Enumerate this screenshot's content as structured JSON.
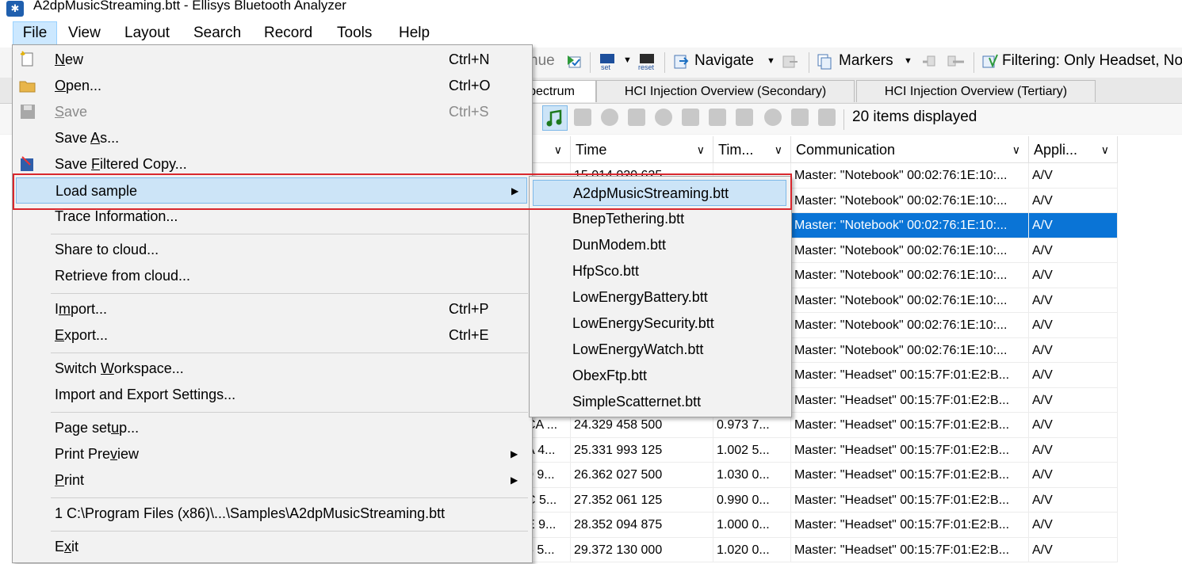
{
  "window": {
    "title": "A2dpMusicStreaming.btt - Ellisys Bluetooth Analyzer"
  },
  "menubar": {
    "items": [
      "File",
      "View",
      "Layout",
      "Search",
      "Record",
      "Tools",
      "Help"
    ]
  },
  "toolbar": {
    "continue_fragment": "nue",
    "set_label": "set",
    "reset_label": "reset",
    "navigate_label": "Navigate",
    "markers_label": "Markers",
    "filtering_label": "Filtering: Only Headset, No"
  },
  "tabs": [
    {
      "label": "pectrum",
      "active": true
    },
    {
      "label": "HCI Injection Overview (Secondary)",
      "active": false
    },
    {
      "label": "HCI Injection Overview (Tertiary)",
      "active": false
    }
  ],
  "toolbar2": {
    "items_displayed": "20 items displayed"
  },
  "grid": {
    "headers": [
      "Time",
      "Tim...",
      "Communication",
      "Appli..."
    ],
    "rows": [
      {
        "c0": "",
        "time": "15.014 020 625",
        "delta": "",
        "comm": "Master: \"Notebook\" 00:02:76:1E:10:...",
        "app": "A/V",
        "selected": false
      },
      {
        "c0": "",
        "time": "",
        "delta": "",
        "comm": "Master: \"Notebook\" 00:02:76:1E:10:...",
        "app": "A/V",
        "selected": false
      },
      {
        "c0": "",
        "time": "",
        "delta": "",
        "comm": "Master: \"Notebook\" 00:02:76:1E:10:...",
        "app": "A/V",
        "selected": true
      },
      {
        "c0": "",
        "time": "",
        "delta": "",
        "comm": "Master: \"Notebook\" 00:02:76:1E:10:...",
        "app": "A/V",
        "selected": false
      },
      {
        "c0": "",
        "time": "",
        "delta": "",
        "comm": "Master: \"Notebook\" 00:02:76:1E:10:...",
        "app": "A/V",
        "selected": false
      },
      {
        "c0": "",
        "time": "",
        "delta": "",
        "comm": "Master: \"Notebook\" 00:02:76:1E:10:...",
        "app": "A/V",
        "selected": false
      },
      {
        "c0": "",
        "time": "",
        "delta": "",
        "comm": "Master: \"Notebook\" 00:02:76:1E:10:...",
        "app": "A/V",
        "selected": false
      },
      {
        "c0": "",
        "time": "",
        "delta": "",
        "comm": "Master: \"Notebook\" 00:02:76:1E:10:...",
        "app": "A/V",
        "selected": false
      },
      {
        "c0": "",
        "time": "",
        "delta": "",
        "comm": "Master: \"Headset\" 00:15:7F:01:E2:B...",
        "app": "A/V",
        "selected": false
      },
      {
        "c0": "",
        "time": "",
        "delta": "",
        "comm": "Master: \"Headset\" 00:15:7F:01:E2:B...",
        "app": "A/V",
        "selected": false
      },
      {
        "c0": "CA ...",
        "time": "24.329 458 500",
        "delta": "0.973 7...",
        "comm": "Master: \"Headset\" 00:15:7F:01:E2:B...",
        "app": "A/V",
        "selected": false
      },
      {
        "c0": "A 4...",
        "time": "25.331 993 125",
        "delta": "1.002 5...",
        "comm": "Master: \"Headset\" 00:15:7F:01:E2:B...",
        "app": "A/V",
        "selected": false
      },
      {
        "c0": "0 9...",
        "time": "26.362 027 500",
        "delta": "1.030 0...",
        "comm": "Master: \"Headset\" 00:15:7F:01:E2:B...",
        "app": "A/V",
        "selected": false
      },
      {
        "c0": "C 5...",
        "time": "27.352 061 125",
        "delta": "0.990 0...",
        "comm": "Master: \"Headset\" 00:15:7F:01:E2:B...",
        "app": "A/V",
        "selected": false
      },
      {
        "c0": "E 9...",
        "time": "28.352 094 875",
        "delta": "1.000 0...",
        "comm": "Master: \"Headset\" 00:15:7F:01:E2:B...",
        "app": "A/V",
        "selected": false
      },
      {
        "c0": "5 5...",
        "time": "29.372 130 000",
        "delta": "1.020 0...",
        "comm": "Master: \"Headset\" 00:15:7F:01:E2:B...",
        "app": "A/V",
        "selected": false
      }
    ]
  },
  "file_menu": {
    "items": [
      {
        "label": "New",
        "shortcut": "Ctrl+N"
      },
      {
        "label": "Open...",
        "shortcut": "Ctrl+O"
      },
      {
        "label": "Save",
        "shortcut": "Ctrl+S"
      },
      {
        "label": "Save As...",
        "shortcut": ""
      },
      {
        "label": "Save Filtered Copy...",
        "shortcut": ""
      },
      {
        "label": "Load sample",
        "shortcut": ""
      },
      {
        "label": "Trace Information...",
        "shortcut": ""
      },
      {
        "label": "Share to cloud...",
        "shortcut": ""
      },
      {
        "label": "Retrieve from cloud...",
        "shortcut": ""
      },
      {
        "label": "Import...",
        "shortcut": "Ctrl+P"
      },
      {
        "label": "Export...",
        "shortcut": "Ctrl+E"
      },
      {
        "label": "Switch Workspace...",
        "shortcut": ""
      },
      {
        "label": "Import and Export Settings...",
        "shortcut": ""
      },
      {
        "label": "Page setup...",
        "shortcut": ""
      },
      {
        "label": "Print Preview",
        "shortcut": ""
      },
      {
        "label": "Print",
        "shortcut": ""
      },
      {
        "label": "1  C:\\Program Files (x86)\\...\\Samples\\A2dpMusicStreaming.btt",
        "shortcut": ""
      },
      {
        "label": "Exit",
        "shortcut": ""
      }
    ]
  },
  "sample_submenu": {
    "items": [
      "A2dpMusicStreaming.btt",
      "BnepTethering.btt",
      "DunModem.btt",
      "HfpSco.btt",
      "LowEnergyBattery.btt",
      "LowEnergySecurity.btt",
      "LowEnergyWatch.btt",
      "ObexFtp.btt",
      "SimpleScatternet.btt"
    ]
  },
  "colors": {
    "selection": "#0a74d6",
    "highlight_box": "#d8272d",
    "menu_hover": "#cce4f7"
  }
}
